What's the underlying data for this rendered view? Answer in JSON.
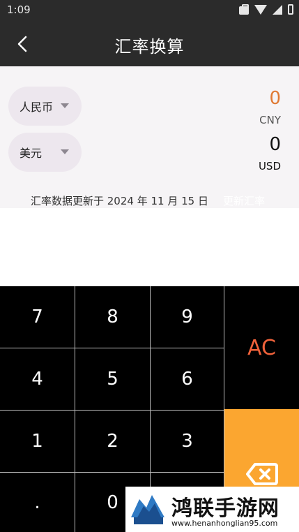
{
  "status_bar": {
    "time": "1:09"
  },
  "app_bar": {
    "title": "汇率换算"
  },
  "converter": {
    "from": {
      "label": "人民币",
      "amount": "0",
      "code": "CNY",
      "color": "#e07a34"
    },
    "to": {
      "label": "美元",
      "amount": "0",
      "code": "USD",
      "color": "#111111"
    }
  },
  "update": {
    "text": "汇率数据更新于 2024 年 11 月 15 日",
    "link": "更新汇率"
  },
  "keypad": {
    "keys": [
      "7",
      "8",
      "9",
      "4",
      "5",
      "6",
      "1",
      "2",
      "3",
      ".",
      "0"
    ],
    "ac_label": "AC",
    "ac_color": "#f0623b",
    "backspace_bg": "#fba630"
  },
  "watermark": {
    "name": "鸿联手游网",
    "url": "www.henanhonglian95.com"
  }
}
